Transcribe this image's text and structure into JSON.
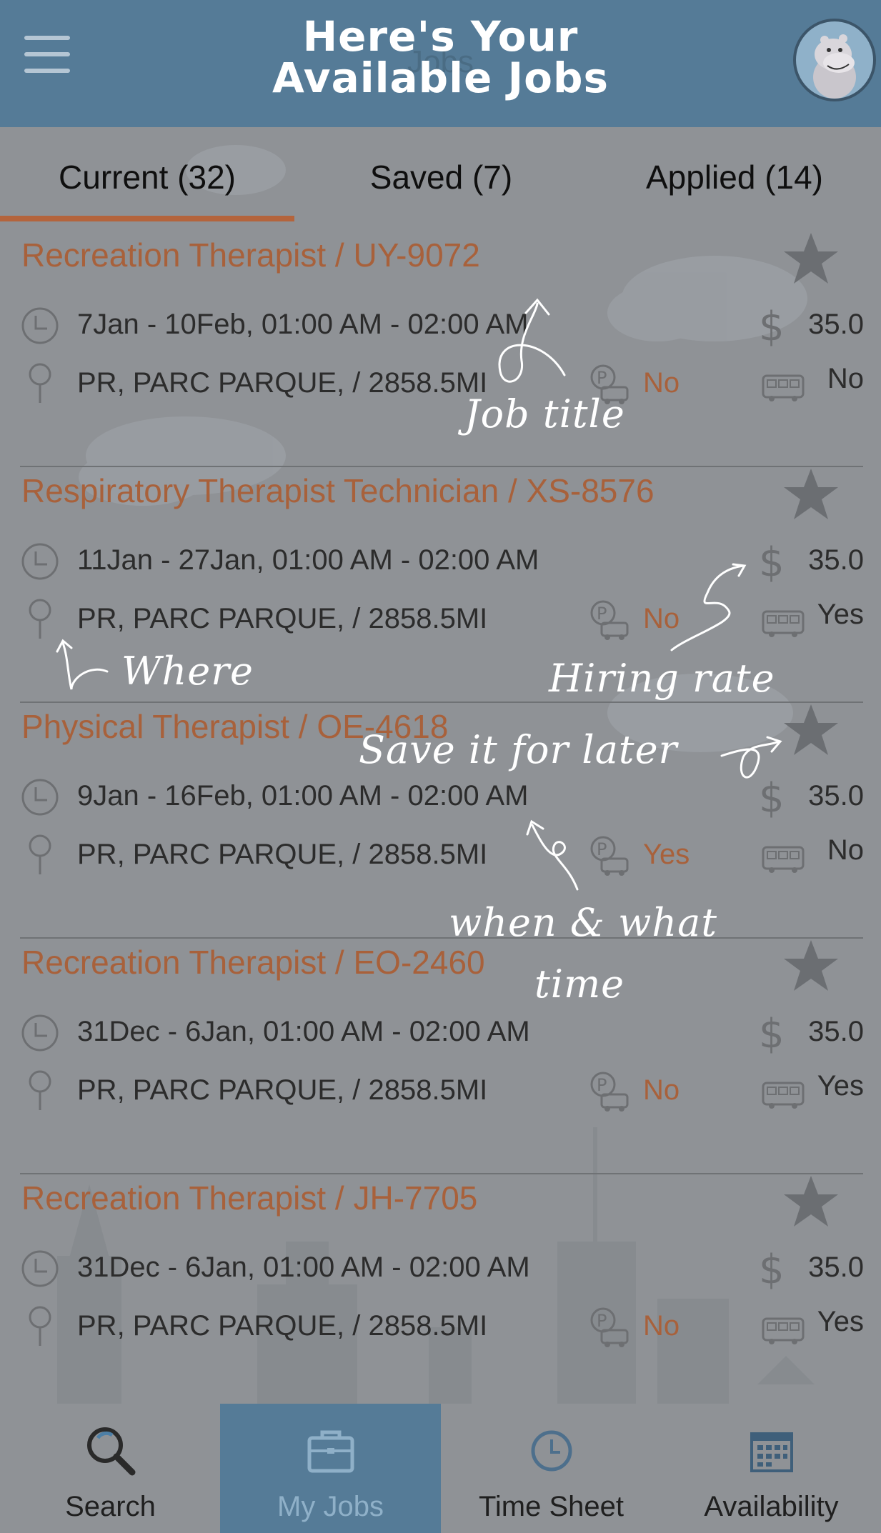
{
  "header": {
    "title_line1": "Here's Your",
    "title_line2": "Available Jobs",
    "ghost_title": "Jobs",
    "menu_icon": "hamburger-icon",
    "avatar_icon": "hippo-avatar"
  },
  "tabs": [
    {
      "label": "Current (32)",
      "active": true
    },
    {
      "label": "Saved (7)",
      "active": false
    },
    {
      "label": "Applied (14)",
      "active": false
    }
  ],
  "jobs": [
    {
      "title": "Recreation Therapist / UY-9072",
      "dates": "7Jan - 10Feb, 01:00 AM  - 02:00 AM",
      "location": "PR, PARC PARQUE,  / 2858.5MI",
      "parking": "No",
      "rate": "35.0",
      "transit": "No"
    },
    {
      "title": "Respiratory Therapist Technician / XS-8576",
      "dates": "11Jan - 27Jan, 01:00 AM  - 02:00 AM",
      "location": "PR, PARC PARQUE,  / 2858.5MI",
      "parking": "No",
      "rate": "35.0",
      "transit": "Yes"
    },
    {
      "title": "Physical Therapist / OE-4618",
      "dates": "9Jan - 16Feb, 01:00 AM  - 02:00 AM",
      "location": "PR, PARC PARQUE,  / 2858.5MI",
      "parking": "Yes",
      "rate": "35.0",
      "transit": "No"
    },
    {
      "title": "Recreation Therapist / EO-2460",
      "dates": "31Dec - 6Jan, 01:00 AM  - 02:00 AM",
      "location": "PR, PARC PARQUE,  / 2858.5MI",
      "parking": "No",
      "rate": "35.0",
      "transit": "Yes"
    },
    {
      "title": "Recreation Therapist / JH-7705",
      "dates": "31Dec - 6Jan, 01:00 AM  - 02:00 AM",
      "location": "PR, PARC PARQUE,  / 2858.5MI",
      "parking": "No",
      "rate": "35.0",
      "transit": "Yes"
    }
  ],
  "annotations": {
    "job_title": "Job title",
    "where": "Where",
    "hiring_rate": "Hiring rate",
    "save_later": "Save it for later",
    "when_line1": "when & what",
    "when_line2": "time"
  },
  "bottom_nav": [
    {
      "label": "Search",
      "icon": "search-icon",
      "active": false
    },
    {
      "label": "My Jobs",
      "icon": "briefcase-icon",
      "active": true
    },
    {
      "label": "Time Sheet",
      "icon": "clock-icon",
      "active": false
    },
    {
      "label": "Availability",
      "icon": "calendar-icon",
      "active": false
    }
  ],
  "colors": {
    "header_bg": "#557b97",
    "overlay_bg": "#8f9296",
    "accent_orange": "#a8613b",
    "tab_underline": "#b4643c",
    "icon_gray": "#6d6f72"
  }
}
